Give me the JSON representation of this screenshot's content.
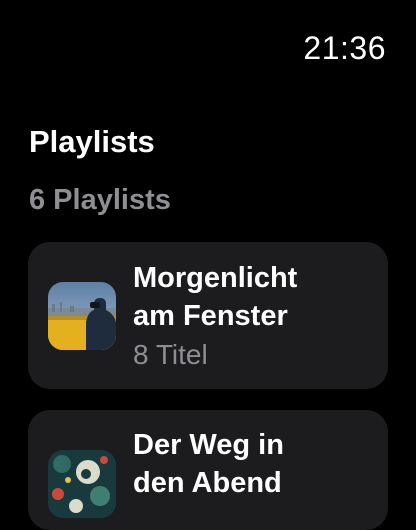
{
  "status": {
    "time": "21:36"
  },
  "header": {
    "title": "Playlists"
  },
  "summary": {
    "count_label": "6 Playlists"
  },
  "playlists": [
    {
      "title": "Morgenlicht\nam Fenster",
      "subtitle": "8 Titel",
      "artwork": "city-view-photo"
    },
    {
      "title": "Der Weg in\nden Abend",
      "subtitle": "",
      "artwork": "dark-teal-abstract-art"
    }
  ],
  "colors": {
    "background": "#000000",
    "card": "#1c1c1e",
    "secondary_text": "#8e8e93"
  }
}
